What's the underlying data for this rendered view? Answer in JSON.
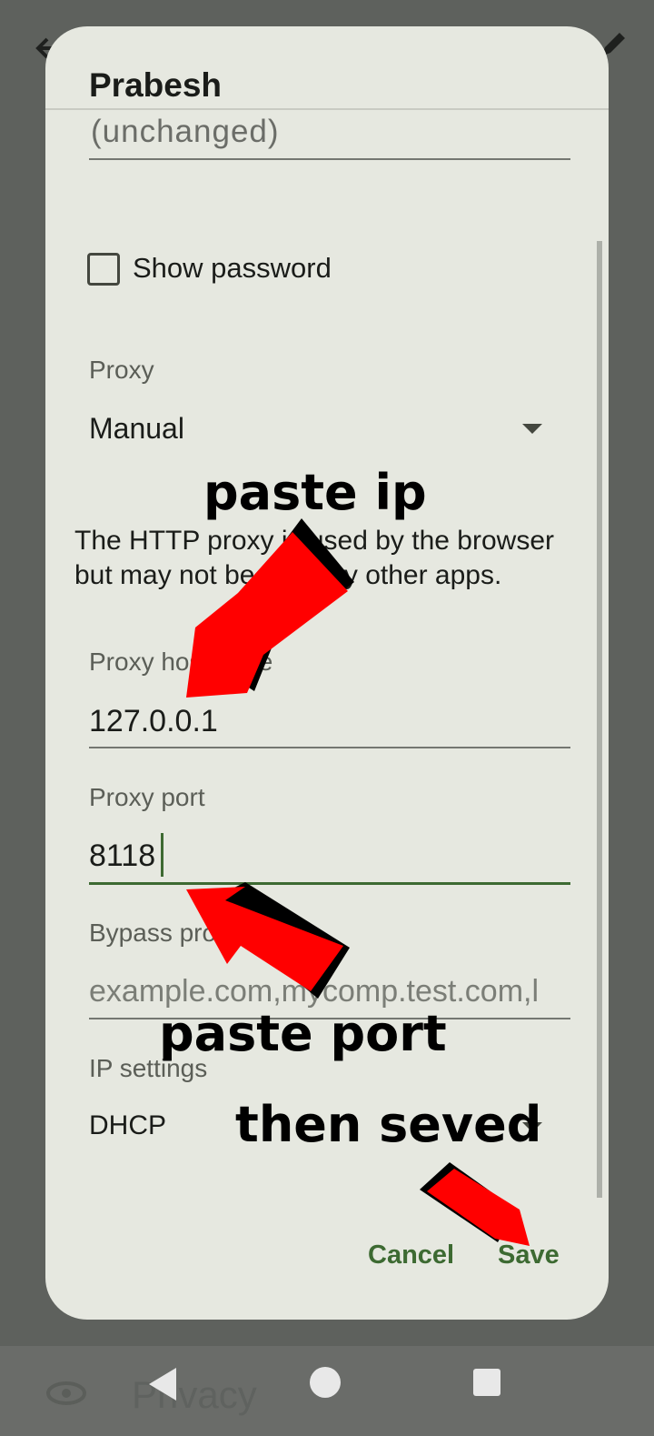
{
  "dialog": {
    "title": "Prabesh",
    "password_value": "(unchanged)",
    "show_password_label": "Show password",
    "proxy": {
      "label": "Proxy",
      "value": "Manual"
    },
    "proxy_note": "The HTTP proxy is used by the browser but may not be used by other apps.",
    "proxy_hostname": {
      "label": "Proxy hostname",
      "value": "127.0.0.1"
    },
    "proxy_port": {
      "label": "Proxy port",
      "value": "8118"
    },
    "bypass_proxy": {
      "label": "Bypass proxy for",
      "placeholder": "example.com,mycomp.test.com,l"
    },
    "ip_settings": {
      "label": "IP settings",
      "value": "DHCP"
    },
    "buttons": {
      "cancel": "Cancel",
      "save": "Save"
    }
  },
  "annotations": {
    "paste_ip": "paste ip",
    "paste_port": "paste port",
    "then_saved": "then seved"
  },
  "nav": {
    "ghost_text": "Privacy"
  },
  "colors": {
    "accent": "#3d6a32",
    "dialog_bg": "#e6e8e0",
    "arrow": "#ff0000"
  }
}
